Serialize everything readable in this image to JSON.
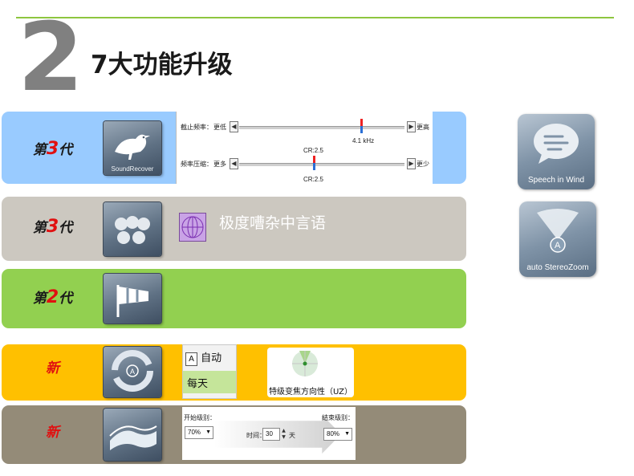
{
  "header": {
    "number": "2",
    "title": "7大功能升级"
  },
  "rows": [
    {
      "gen_prefix": "第",
      "gen_num": "3",
      "gen_suffix": "代",
      "icon_caption": "SoundRecover",
      "slider1": {
        "label": "截止频率：",
        "left": "更低",
        "right": "更高",
        "value": "4.1 kHz"
      },
      "slider2": {
        "label": "频率压缩：",
        "left": "更多",
        "right": "更少",
        "value_top": "CR:2.5",
        "value_bottom": "CR:2.5"
      }
    },
    {
      "gen_prefix": "第",
      "gen_num": "3",
      "gen_suffix": "代",
      "text": "极度嘈杂中言语"
    },
    {
      "gen_prefix": "第",
      "gen_num": "2",
      "gen_suffix": "代"
    },
    {
      "gen_label": "新",
      "auto_badge": "A",
      "auto_text": "自动",
      "daily_text": "每天",
      "uz_text": "特级变焦方向性（UZ）"
    },
    {
      "gen_label": "新",
      "start_label": "开始级别：",
      "start_value": "70%",
      "time_label": "时间：",
      "time_value": "30",
      "time_unit": "天",
      "end_label": "结束级别：",
      "end_value": "80%"
    }
  ],
  "side": [
    {
      "caption": "Speech in Wind"
    },
    {
      "caption": "auto StereoZoom",
      "badge": "A"
    }
  ],
  "colors": {
    "row1": "#99cbff",
    "row2": "#ccc8c0",
    "row3": "#92d050",
    "row4": "#ffc000",
    "row5": "#948b78",
    "accent_red": "#e01010",
    "line_green": "#8dc63f"
  }
}
